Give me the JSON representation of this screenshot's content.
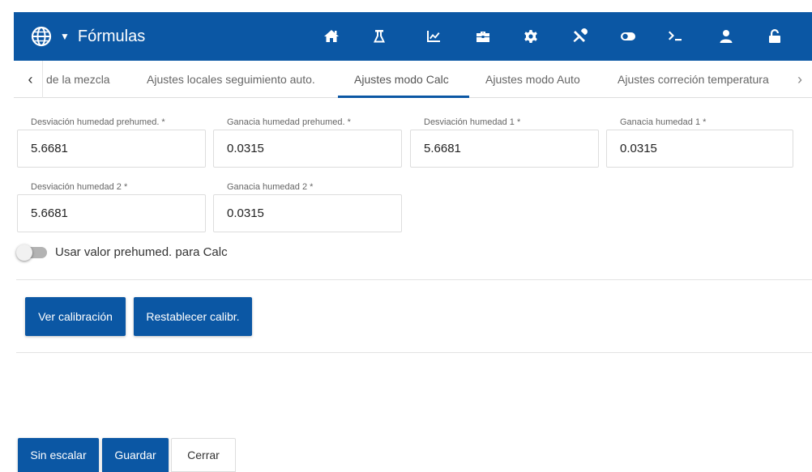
{
  "header": {
    "title": "Fórmulas",
    "bg_color": "#0b57a4",
    "icons": [
      "home-icon",
      "flask-icon",
      "chart-icon",
      "briefcase-icon",
      "gear-icon",
      "tools-icon",
      "toggle-icon",
      "terminal-icon",
      "user-icon",
      "unlock-icon"
    ]
  },
  "tabs": {
    "items": [
      {
        "label": "de la mezcla"
      },
      {
        "label": "Ajustes locales seguimiento auto."
      },
      {
        "label": "Ajustes modo Calc"
      },
      {
        "label": "Ajustes modo Auto"
      },
      {
        "label": "Ajustes correción temperatura"
      }
    ],
    "active": "Ajustes modo Calc",
    "prev_arrow": "‹",
    "next_arrow": "›"
  },
  "form": {
    "fields": [
      {
        "label": "Desviación humedad prehumed. *",
        "value": "5.6681"
      },
      {
        "label": "Ganacia humedad prehumed. *",
        "value": "0.0315"
      },
      {
        "label": "Desviación humedad 1 *",
        "value": "5.6681"
      },
      {
        "label": "Ganacia humedad 1 *",
        "value": "0.0315"
      },
      {
        "label": "Desviación humedad 2 *",
        "value": "5.6681"
      },
      {
        "label": "Ganacia humedad 2 *",
        "value": "0.0315"
      }
    ],
    "toggle": {
      "label": "Usar valor prehumed. para Calc",
      "checked": false
    }
  },
  "actions": {
    "ver_calibracion": "Ver calibración",
    "restablecer": "Restablecer calibr."
  },
  "footer": {
    "sin_escalar": "Sin escalar",
    "guardar": "Guardar",
    "cerrar": "Cerrar"
  }
}
